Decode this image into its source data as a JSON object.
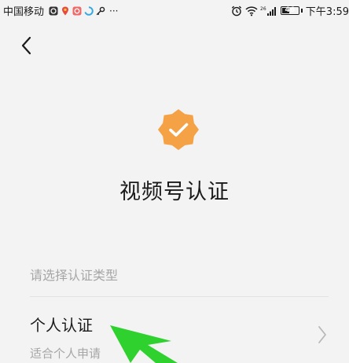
{
  "status_bar": {
    "carrier": "中国移动",
    "more": "···",
    "network_type": "26",
    "battery_level": 46,
    "battery_label": "46",
    "time": "下午3:59"
  },
  "icons": {
    "back": "back-chevron-icon",
    "badge": "verified-badge-icon",
    "chevron": "chevron-right-icon"
  },
  "colors": {
    "badge": "#f5a246",
    "arrow": "#2ed12e"
  },
  "page": {
    "title": "视频号认证"
  },
  "options_section": {
    "hint": "请选择认证类型",
    "items": [
      {
        "title": "个人认证",
        "description": "适合个人申请"
      }
    ]
  }
}
